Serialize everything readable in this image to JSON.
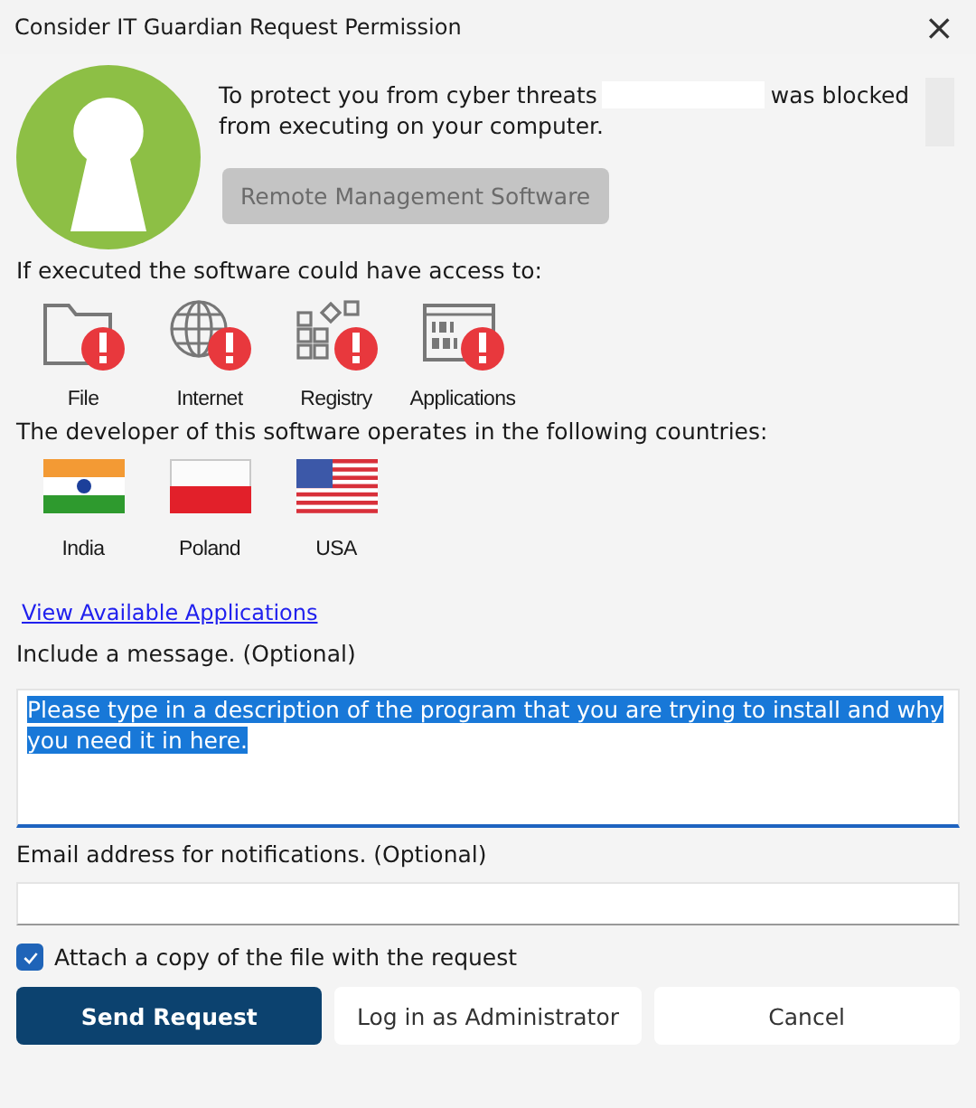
{
  "window": {
    "title": "Consider IT Guardian Request Permission",
    "close": "×"
  },
  "notice": {
    "before": "To protect you from cyber threats",
    "after": "was blocked",
    "second_line": "from executing on your computer.",
    "redacted": true
  },
  "software_button": {
    "label": "Remote Management Software",
    "disabled": true
  },
  "access": {
    "heading": "If executed the software could have access to:",
    "items": [
      {
        "kind": "file",
        "label": "File"
      },
      {
        "kind": "internet",
        "label": "Internet"
      },
      {
        "kind": "registry",
        "label": "Registry"
      },
      {
        "kind": "applications",
        "label": "Applications"
      }
    ]
  },
  "countries": {
    "heading": "The developer of this software operates in the following countries:",
    "items": [
      {
        "kind": "india",
        "label": "India"
      },
      {
        "kind": "poland",
        "label": "Poland"
      },
      {
        "kind": "usa",
        "label": "USA"
      }
    ]
  },
  "link": "View Available Applications",
  "message": {
    "label": "Include a message. (Optional)",
    "value": "Please type in a description of the program that you are trying to install and why you need it in here.",
    "highlighted": true,
    "focused": true
  },
  "email": {
    "label": "Email address for notifications. (Optional)"
  },
  "attach": {
    "label": "Attach a copy of the file with the request",
    "checked": true
  },
  "buttons": [
    {
      "label": "Send Request",
      "kind": "primary"
    },
    {
      "label": "Log in as Administrator",
      "kind": "secondary"
    },
    {
      "label": "Cancel",
      "kind": "secondary"
    }
  ]
}
